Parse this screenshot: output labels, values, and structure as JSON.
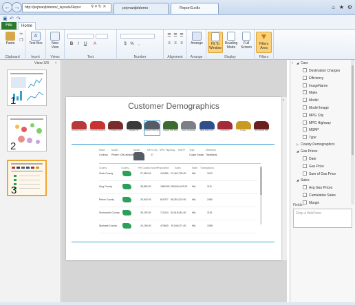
{
  "browser": {
    "address": "http://pejmanjbidemo/_layouts/Repor",
    "tab_active": "pejmanjbidemo",
    "tab_report": "Report1.rdlx"
  },
  "ribbon": {
    "file_tab": "File",
    "home_tab": "Home",
    "groups": {
      "clipboard": "Clipboard",
      "insert": "Insert",
      "views": "Views",
      "text": "Text",
      "number": "Number",
      "alignment": "Alignment",
      "arrange": "Arrange",
      "display": "Display",
      "filters": "Filters"
    },
    "buttons": {
      "paste": "Paste",
      "text_box": "Text Box",
      "new_view": "New View",
      "arrange": "Arrange",
      "fit_to_window": "Fit To Window",
      "reading_mode": "Reading Mode",
      "full_screen": "Full Screen",
      "filters_area": "Filters Area"
    }
  },
  "thumbs": {
    "view_label": "View 3/3",
    "nums": [
      "1",
      "2",
      "3"
    ]
  },
  "report": {
    "title": "Customer Demographics",
    "cars": [
      {
        "label": "Cambio Sport Cup",
        "color": "#b8393a"
      },
      {
        "label": "Ferreria Adelante",
        "color": "#c9332f"
      },
      {
        "label": "Pinnacle 200",
        "color": "#7a2b2b"
      },
      {
        "label": "Vagabond",
        "color": "#3b3b3b"
      },
      {
        "label": "Pewee 1000 amarilla",
        "color": "#555c66"
      },
      {
        "label": "Adagio 500 Hbd",
        "color": "#3d6b2f"
      },
      {
        "label": "Vellor Roadster",
        "color": "#7a7f88"
      },
      {
        "label": "Blue Diamond",
        "color": "#2e4f8c"
      },
      {
        "label": "Cranberry",
        "color": "#a22c3a"
      },
      {
        "label": "Fuego",
        "color": "#c99a1f"
      },
      {
        "label": "Sol Azteca 300",
        "color": "#6b1f1f"
      }
    ],
    "details_headers": [
      "Make",
      "Model",
      "Model",
      "MPG City",
      "MPG Highway",
      "MSRP",
      "Type",
      "Efficiency"
    ],
    "details_row": [
      "Contoso",
      "Pewee 1000 amarilla",
      "",
      "27",
      "",
      "",
      "Coupe Sedan",
      "Traditional"
    ],
    "county_headers": [
      "County",
      "County...",
      "Per Capita Income",
      "Population",
      "Sales",
      "State",
      "Transactions"
    ],
    "counties": [
      {
        "name": "Clark County",
        "income": "27,054.00",
        "pop": "410480",
        "sales": "21,492,730.00",
        "state": "WA",
        "tx": "1012"
      },
      {
        "name": "King County",
        "income": "38,562.00",
        "pop": "1862400",
        "sales": "283,834,476.00",
        "state": "WA",
        "tx": "1111"
      },
      {
        "name": "Pierce County",
        "income": "25,942.00",
        "pop": "810377",
        "sales": "58,262,022.00",
        "state": "WA",
        "tx": "2450"
      },
      {
        "name": "Snohomish County",
        "income": "30,192.00",
        "pop": "712314",
        "sales": "63,018,051.00",
        "state": "WA",
        "tx": "1151"
      },
      {
        "name": "Spokane County",
        "income": "24,194.00",
        "pop": "474600",
        "sales": "29,198,071.00",
        "state": "WA",
        "tx": "1058"
      }
    ]
  },
  "fields": {
    "tables": [
      {
        "name": "Cars",
        "items": [
          "Destination Charges",
          "Efficiency",
          "ImageName",
          "Make",
          "Model",
          "Model Image",
          "MPG City",
          "MPG Highway",
          "MSRP",
          "Type"
        ]
      },
      {
        "name": "County Demographics",
        "items": []
      },
      {
        "name": "Gas Prices",
        "items": [
          "Date",
          "Gas Price",
          "Sum of Gas Price"
        ]
      },
      {
        "name": "Sales",
        "items": [
          "Avg Gas Prices",
          "Cumulative Sales",
          "Margin"
        ]
      }
    ],
    "fields_label": "Fields:",
    "drop_placeholder": "Drop a field here"
  },
  "colors": {
    "accent_orange": "#f0a530",
    "file_green": "#2b7a2b",
    "rule_blue": "#3aa0d0",
    "county_green": "#2ca05a"
  }
}
